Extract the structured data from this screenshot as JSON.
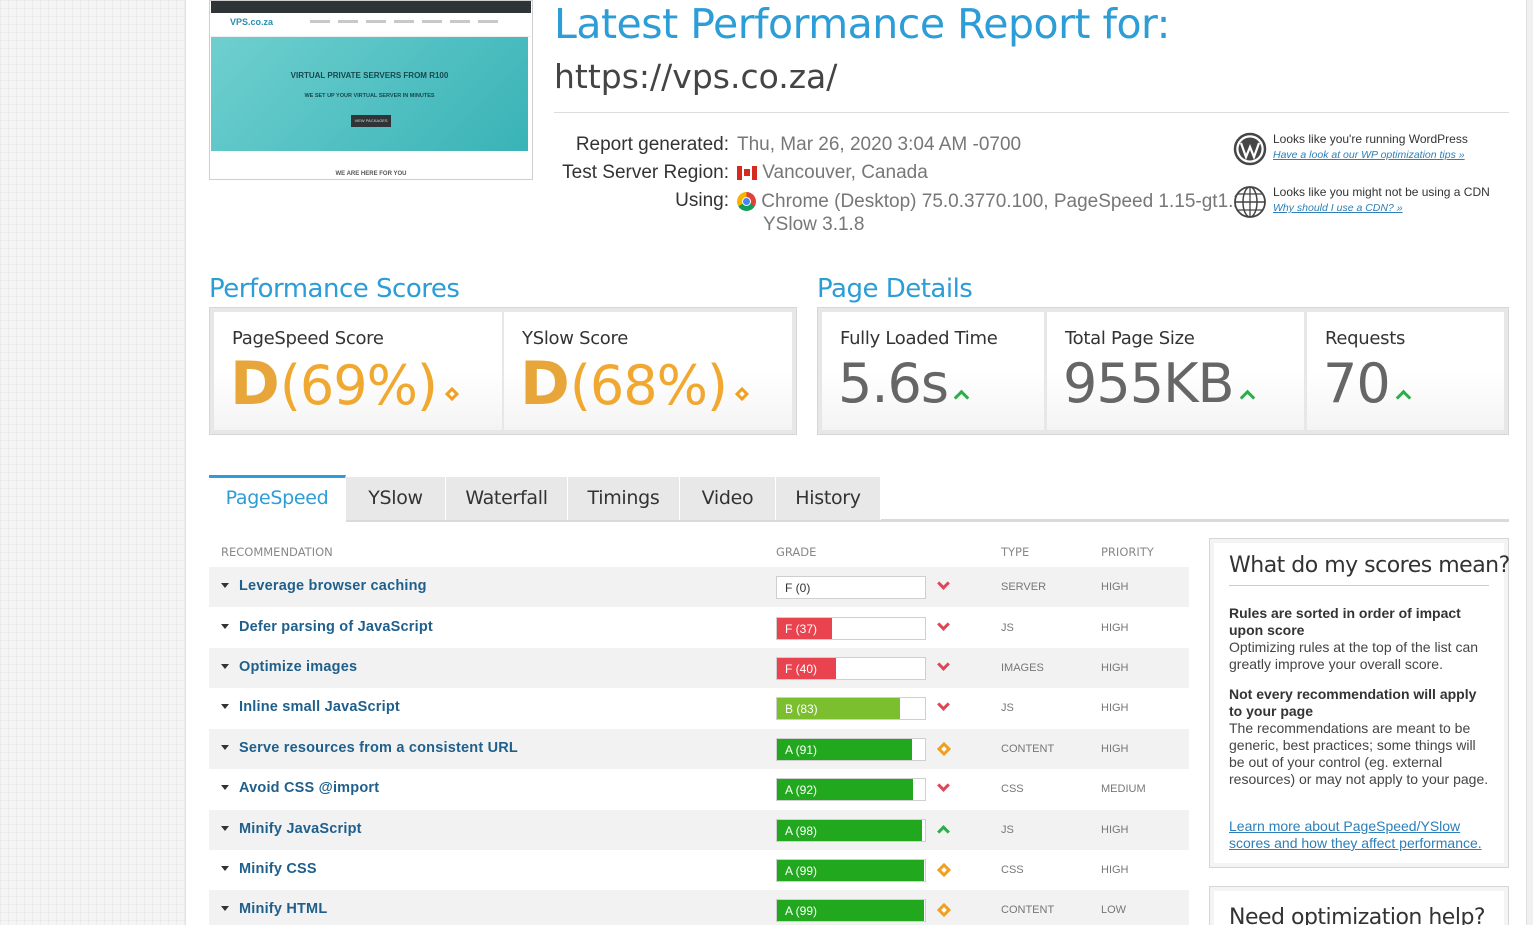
{
  "thumbnail": {
    "logo": "VPS.co.za",
    "hero_title": "VIRTUAL PRIVATE SERVERS FROM R100",
    "hero_sub": "WE SET UP YOUR VIRTUAL SERVER IN MINUTES",
    "hero_button": "VIEW PACKAGES",
    "bottom_text": "WE ARE HERE FOR YOU"
  },
  "report": {
    "title": "Latest Performance Report for:",
    "url": "https://vps.co.za/",
    "generated_label": "Report generated:",
    "generated_value": "Thu, Mar 26, 2020 3:04 AM -0700",
    "region_label": "Test Server Region:",
    "region_value": "Vancouver, Canada",
    "using_label": "Using:",
    "using_value_line1": "Chrome (Desktop) 75.0.3770.100, PageSpeed 1.15-gt1.2,",
    "using_value_line2": "YSlow 3.1.8"
  },
  "notices": [
    {
      "text": "Looks like you're running WordPress",
      "link": "Have a look at our WP optimization tips »",
      "icon": "wordpress-icon"
    },
    {
      "text": "Looks like you might not be using a CDN",
      "link": "Why should I use a CDN? »",
      "icon": "globe-icon"
    }
  ],
  "performance": {
    "heading": "Performance Scores",
    "pagespeed_label": "PageSpeed Score",
    "pagespeed_grade": "D",
    "pagespeed_pct": "(69%)",
    "yslow_label": "YSlow Score",
    "yslow_grade": "D",
    "yslow_pct": "(68%)"
  },
  "details": {
    "heading": "Page Details",
    "load_label": "Fully Loaded Time",
    "load_value": "5.6s",
    "size_label": "Total Page Size",
    "size_value": "955KB",
    "req_label": "Requests",
    "req_value": "70"
  },
  "tabs": [
    "PageSpeed",
    "YSlow",
    "Waterfall",
    "Timings",
    "Video",
    "History"
  ],
  "table": {
    "headers": {
      "recommendation": "RECOMMENDATION",
      "grade": "GRADE",
      "type": "TYPE",
      "priority": "PRIORITY"
    },
    "rows": [
      {
        "name": "Leverage browser caching",
        "grade": "F (0)",
        "score": 0,
        "type": "SERVER",
        "priority": "HIGH",
        "trend": "down"
      },
      {
        "name": "Defer parsing of JavaScript",
        "grade": "F (37)",
        "score": 37,
        "type": "JS",
        "priority": "HIGH",
        "trend": "down"
      },
      {
        "name": "Optimize images",
        "grade": "F (40)",
        "score": 40,
        "type": "IMAGES",
        "priority": "HIGH",
        "trend": "down"
      },
      {
        "name": "Inline small JavaScript",
        "grade": "B (83)",
        "score": 83,
        "type": "JS",
        "priority": "HIGH",
        "trend": "down"
      },
      {
        "name": "Serve resources from a consistent URL",
        "grade": "A (91)",
        "score": 91,
        "type": "CONTENT",
        "priority": "HIGH",
        "trend": "same"
      },
      {
        "name": "Avoid CSS @import",
        "grade": "A (92)",
        "score": 92,
        "type": "CSS",
        "priority": "MEDIUM",
        "trend": "down"
      },
      {
        "name": "Minify JavaScript",
        "grade": "A (98)",
        "score": 98,
        "type": "JS",
        "priority": "HIGH",
        "trend": "up"
      },
      {
        "name": "Minify CSS",
        "grade": "A (99)",
        "score": 99,
        "type": "CSS",
        "priority": "HIGH",
        "trend": "same"
      },
      {
        "name": "Minify HTML",
        "grade": "A (99)",
        "score": 99,
        "type": "CONTENT",
        "priority": "LOW",
        "trend": "same"
      }
    ]
  },
  "sidebar": {
    "title": "What do my scores mean?",
    "p1_bold": "Rules are sorted in order of impact upon score",
    "p1_text": "Optimizing rules at the top of the list can greatly improve your overall score.",
    "p2_bold": "Not every recommendation will apply to your page",
    "p2_text": "The recommendations are meant to be generic, best practices; some things will be out of your control (eg. external resources) or may not apply to your page.",
    "link": "Learn more about PageSpeed/YSlow scores and how they affect performance.",
    "help_title": "Need optimization help?"
  },
  "colors": {
    "accent": "#2c9dd6",
    "grade_f": "#e8434f",
    "grade_b": "#7bbf2f",
    "grade_a": "#22a81e",
    "grade_d": "#e8a63a"
  }
}
